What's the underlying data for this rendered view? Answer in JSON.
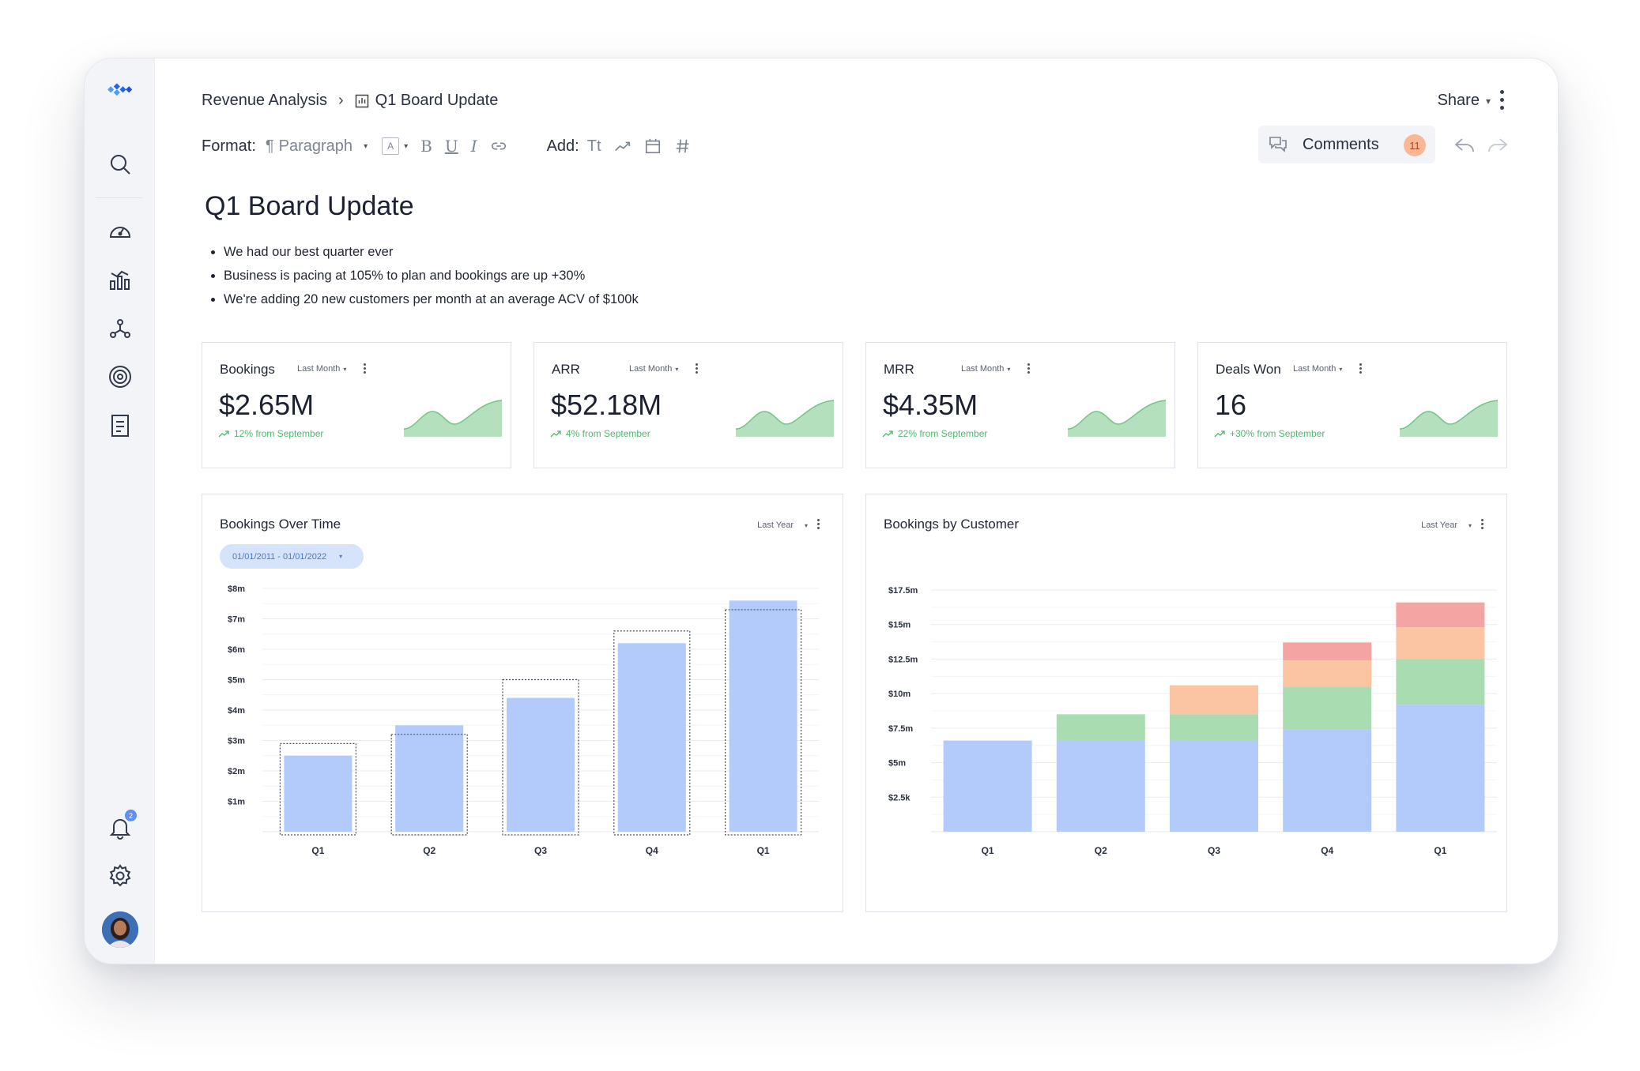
{
  "app": {
    "breadcrumb": {
      "parent": "Revenue Analysis",
      "current": "Q1 Board Update"
    },
    "share_label": "Share",
    "comments": {
      "label": "Comments",
      "count": "11"
    },
    "notification_count": "2"
  },
  "toolbar": {
    "format_label": "Format:",
    "paragraph_label": "Paragraph",
    "font_size_icon": "A",
    "bold": "B",
    "underline": "U",
    "italic": "I",
    "add_label": "Add:",
    "text_icon": "Tt"
  },
  "document": {
    "title": "Q1 Board Update",
    "bullets": [
      "We had our best quarter ever",
      "Business is pacing at 105% to plan and bookings are up +30%",
      "We're adding 20 new customers per month at an average ACV of $100k"
    ]
  },
  "kpis": [
    {
      "title": "Bookings",
      "filter": "Last Month",
      "value": "$2.65M",
      "delta": "12% from September"
    },
    {
      "title": "ARR",
      "filter": "Last Month",
      "value": "$52.18M",
      "delta": "4% from September"
    },
    {
      "title": "MRR",
      "filter": "Last Month",
      "value": "$4.35M",
      "delta": "22% from September"
    },
    {
      "title": "Deals Won",
      "filter": "Last Month",
      "value": "16",
      "delta": "+30% from September"
    }
  ],
  "panels": {
    "bookings_over_time": {
      "title": "Bookings Over Time",
      "filter": "Last Year",
      "date_range": "01/01/2011 - 01/01/2022"
    },
    "bookings_by_customer": {
      "title": "Bookings by Customer",
      "filter": "Last Year"
    }
  },
  "colors": {
    "bar_blue": "#b3cbfb",
    "green": "#a9dcb1",
    "orange": "#fbc4a3",
    "red": "#f4a4a2",
    "spark_fill": "#b5e0bd",
    "spark_line": "#72c488",
    "accent_green": "#4cb86e"
  },
  "chart_data": [
    {
      "type": "bar",
      "title": "Bookings Over Time",
      "categories": [
        "Q1",
        "Q2",
        "Q3",
        "Q4",
        "Q1"
      ],
      "y_tick_labels": [
        "$1m",
        "$2m",
        "$3m",
        "$4m",
        "$5m",
        "$6m",
        "$7m",
        "$8m"
      ],
      "ylim": [
        0,
        8
      ],
      "series": [
        {
          "name": "",
          "values": [
            2.5,
            3.5,
            4.4,
            6.2,
            7.6
          ]
        }
      ],
      "target_outline": [
        2.9,
        3.2,
        5.0,
        6.6,
        7.3
      ],
      "grid": true
    },
    {
      "type": "bar",
      "title": "Bookings by Customer",
      "stacked": true,
      "categories": [
        "Q1",
        "Q2",
        "Q3",
        "Q4",
        "Q1"
      ],
      "y_tick_labels": [
        "$2.5k",
        "$5m",
        "$7.5m",
        "$10m",
        "$12.5m",
        "$15m",
        "$17.5m"
      ],
      "ylim": [
        0,
        17.5
      ],
      "series": [
        {
          "name": "",
          "color": "bar_blue",
          "values": [
            6.6,
            6.6,
            6.6,
            7.4,
            9.2
          ]
        },
        {
          "name": "",
          "color": "green",
          "values": [
            0,
            1.9,
            1.9,
            3.1,
            3.3
          ]
        },
        {
          "name": "",
          "color": "orange",
          "values": [
            0,
            0,
            2.1,
            1.9,
            2.3
          ]
        },
        {
          "name": "",
          "color": "red",
          "values": [
            0,
            0,
            0,
            1.3,
            1.8
          ]
        }
      ],
      "grid": true
    }
  ]
}
